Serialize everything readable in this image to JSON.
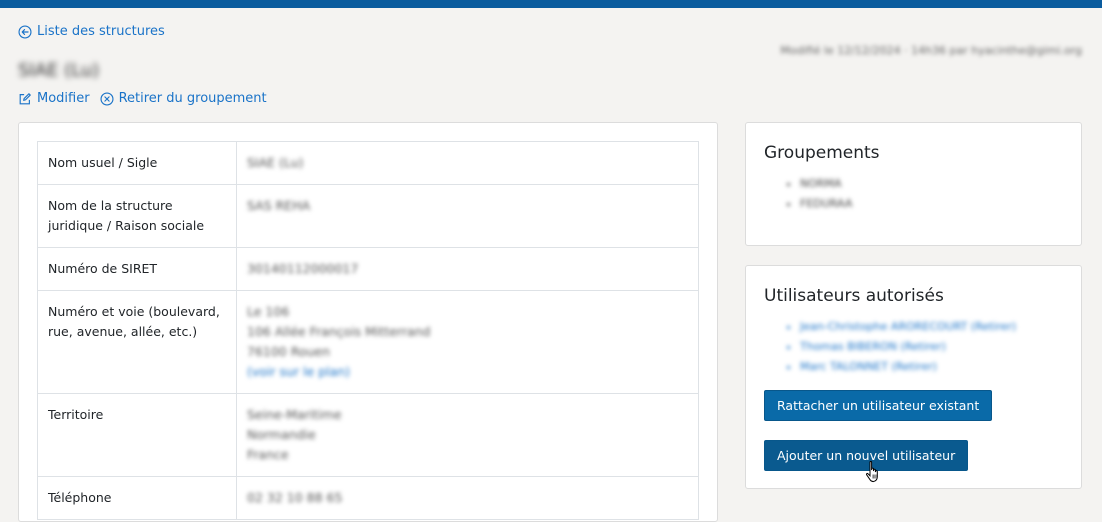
{
  "nav": {
    "back_label": "Liste des structures"
  },
  "page": {
    "title": "SIAE (Lu)",
    "modified": "Modifié le 12/12/2024 · 14h36 par hyacinthe@gimi.org",
    "actions": {
      "edit_label": "Modifier",
      "remove_label": "Retirer du groupement"
    }
  },
  "info": {
    "rows": [
      {
        "label": "Nom usuel / Sigle",
        "lines": [
          "SIAE (Lu)"
        ]
      },
      {
        "label": "Nom de la structure juridique / Raison sociale",
        "lines": [
          "SAS REHA"
        ]
      },
      {
        "label": "Numéro de SIRET",
        "lines": [
          "30140112000017"
        ]
      },
      {
        "label": "Numéro et voie (boulevard, rue, avenue, allée, etc.)",
        "lines": [
          "Le 106",
          "106 Allée François Mitterrand",
          "76100 Rouen"
        ],
        "link": "(voir sur le plan)"
      },
      {
        "label": "Territoire",
        "lines": [
          "Seine-Maritime",
          "Normandie",
          "France"
        ]
      },
      {
        "label": "Téléphone",
        "lines": [
          "02 32 10 88 65"
        ]
      }
    ]
  },
  "groups": {
    "title": "Groupements",
    "items": [
      "NORMA",
      "FEDURAA"
    ]
  },
  "users": {
    "title": "Utilisateurs autorisés",
    "items": [
      "Jean-Christophe ARORECOURT (Retirer)",
      "Thomas BIBERON (Retirer)",
      "Marc TALONNET (Retirer)"
    ],
    "attach_label": "Rattacher un utilisateur existant",
    "add_label": "Ajouter un nouvel utilisateur"
  },
  "colors": {
    "brand": "#0a5c9e",
    "link": "#1a73c8",
    "button": "#0a6aa8"
  },
  "icons": {
    "back": "arrow-circle-left-icon",
    "edit": "edit-icon",
    "remove": "close-circle-icon",
    "cursor": "hand-pointer-icon"
  }
}
